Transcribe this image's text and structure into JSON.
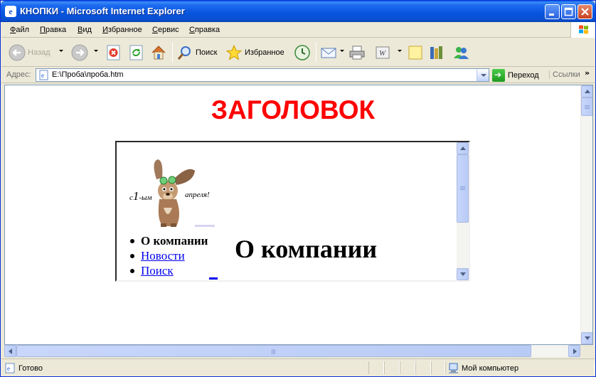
{
  "window": {
    "title": "КНОПКИ - Microsoft Internet Explorer"
  },
  "menu": [
    "Файл",
    "Правка",
    "Вид",
    "Избранное",
    "Сервис",
    "Справка"
  ],
  "toolbar": {
    "back_label": "Назад",
    "search_label": "Поиск",
    "favorites_label": "Избранное"
  },
  "address": {
    "label": "Адрес:",
    "value": "E:\\Проба\\проба.htm",
    "go_label": "Переход",
    "links_label": "Ссылки",
    "more": "»"
  },
  "page": {
    "heading": "ЗАГОЛОВОК",
    "heading_color": "#ff0000",
    "iframe": {
      "banner_left_prefix": "с",
      "banner_left_number": "1",
      "banner_left_suffix": "-ым",
      "banner_right": "апреля!",
      "nav": [
        {
          "label": "О компании",
          "current": true
        },
        {
          "label": "Новости",
          "current": false
        },
        {
          "label": "Поиск",
          "current": false
        }
      ],
      "main_title": "О компании"
    }
  },
  "status": {
    "left": "Готово",
    "zone": "Мой компьютер"
  },
  "colors": {
    "title_bar": "#0854dd",
    "link": "#0000ee",
    "chrome": "#ece9d8"
  }
}
